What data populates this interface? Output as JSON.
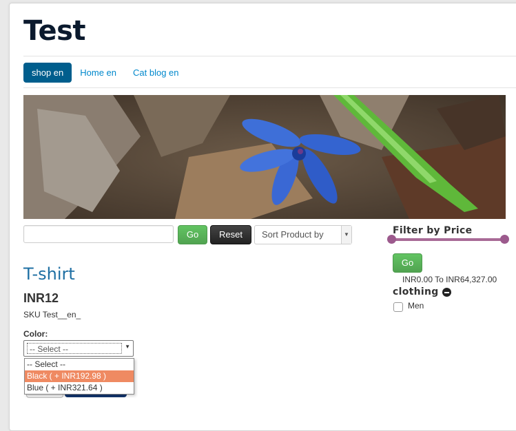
{
  "site": {
    "title": "Test"
  },
  "nav": {
    "items": [
      {
        "label": "shop en",
        "active": true
      },
      {
        "label": "Home en",
        "active": false
      },
      {
        "label": "Cat blog en",
        "active": false
      }
    ]
  },
  "search": {
    "value": "",
    "placeholder": "",
    "go_label": "Go",
    "reset_label": "Reset"
  },
  "sort": {
    "selected": "Sort Product by"
  },
  "product": {
    "title": "T-shirt",
    "price": "INR12",
    "sku": "SKU Test__en_",
    "color_label": "Color:",
    "color_selected": "-- Select --",
    "color_options": [
      {
        "label": "-- Select --",
        "highlighted": false
      },
      {
        "label": "Black ( + INR192.98 )",
        "highlighted": true
      },
      {
        "label": "Blue ( + INR321.64 )",
        "highlighted": false
      }
    ]
  },
  "filter": {
    "title": "Filter by Price",
    "go_label": "Go",
    "range_text": "INR0.00 To INR64,327.00",
    "slider_min_fraction": 0,
    "slider_max_fraction": 1
  },
  "category": {
    "title": "clothing",
    "icon": "minus-circle-icon",
    "options": [
      {
        "label": "Men",
        "checked": false
      }
    ]
  },
  "colors": {
    "nav_active": "#005e8d",
    "link": "#0088cc",
    "go_green": "#51a351",
    "slider": "#a86a96",
    "highlight": "#ef8a62"
  }
}
